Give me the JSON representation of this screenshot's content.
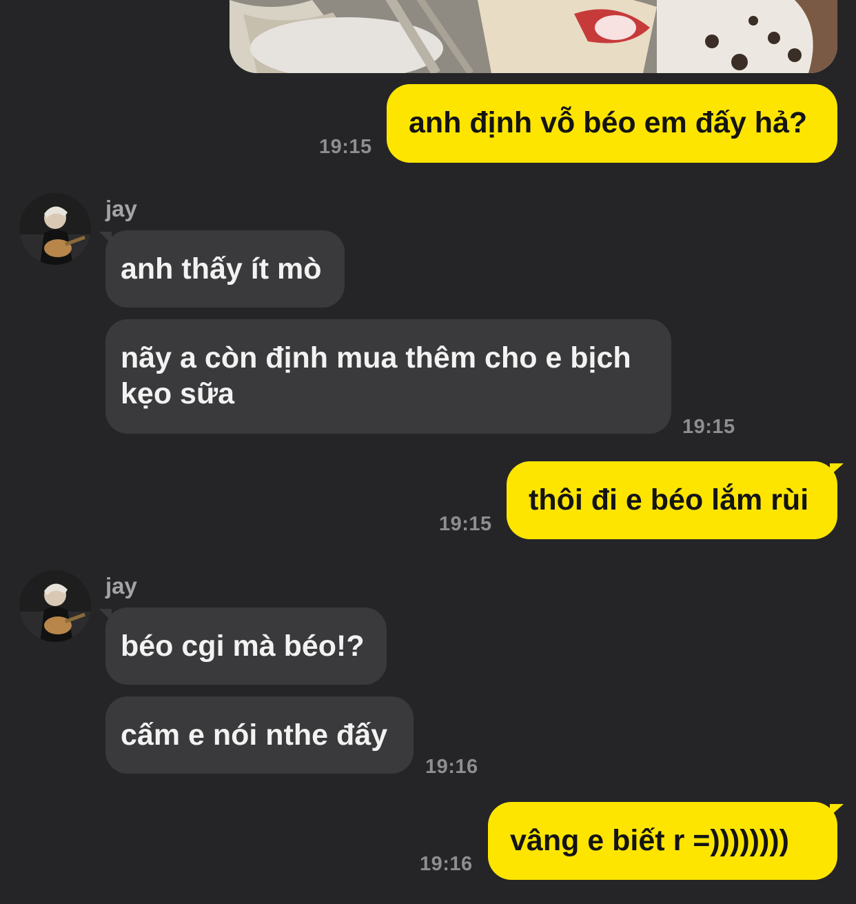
{
  "chat": {
    "messages": [
      {
        "id": "m1",
        "from": "me",
        "text": "anh định vỗ béo em đấy hả?",
        "time": "19:15"
      },
      {
        "id": "m2",
        "from": "jay",
        "sender": "jay",
        "text": "anh thấy ít mò"
      },
      {
        "id": "m3",
        "from": "jay",
        "text": "nãy a còn định mua thêm cho e bịch kẹo sữa",
        "time": "19:15"
      },
      {
        "id": "m4",
        "from": "me",
        "text": "thôi đi e béo lắm rùi",
        "time": "19:15"
      },
      {
        "id": "m5",
        "from": "jay",
        "sender": "jay",
        "text": "béo cgi mà béo!?"
      },
      {
        "id": "m6",
        "from": "jay",
        "text": "cấm e nói nthe đấy",
        "time": "19:16"
      },
      {
        "id": "m7",
        "from": "me",
        "text": "vâng e biết r =))))))))",
        "time": "19:16"
      }
    ]
  },
  "colors": {
    "background": "#252527",
    "my_bubble": "#fee500",
    "their_bubble": "#3a3a3c",
    "timestamp": "#8e8e92"
  },
  "icons": {
    "avatar": "profile-photo-guitar"
  }
}
